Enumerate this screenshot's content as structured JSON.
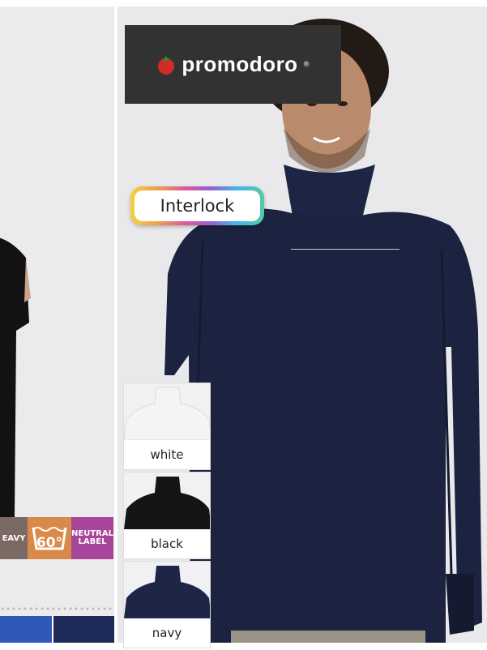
{
  "brand": {
    "name": "promodoro",
    "registered_mark": "®"
  },
  "fabric_badge": {
    "label": "Interlock"
  },
  "care_badges": {
    "heavy": "EAVY",
    "wash_temp": "60°",
    "neutral": "NEUTRAL\nLABEL"
  },
  "colors_list": [
    {
      "label": "white",
      "hex": "#f4f4f4"
    },
    {
      "label": "black",
      "hex": "#141414"
    },
    {
      "label": "navy",
      "hex": "#1d2647"
    }
  ],
  "colors": {
    "logo_bg": "#333232",
    "shirt_navy": "#1c2340",
    "badge_heavy": "#7a6a63",
    "badge_wash": "#d9894a",
    "badge_neutral": "#a6459a",
    "left_blue": "#2f58b8",
    "left_darkblue": "#1f2c5a"
  }
}
